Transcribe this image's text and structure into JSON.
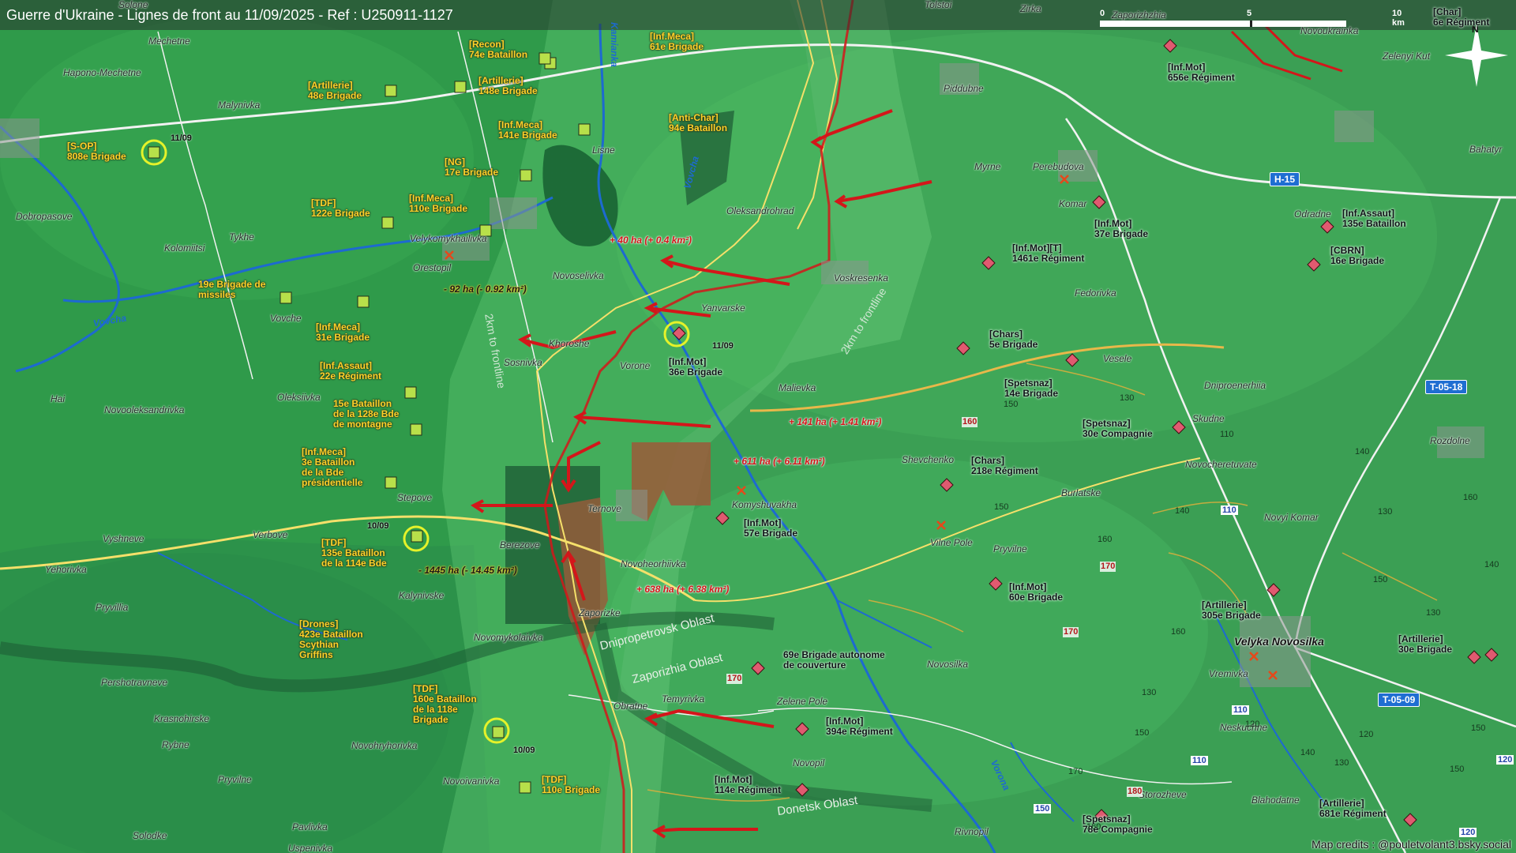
{
  "title": "Guerre d'Ukraine - Lignes de front au 11/09/2025 - Ref : U250911-1127",
  "credits": "Map credits : @pouletvolant3.bsky.social",
  "scale": {
    "zero": "0",
    "mid": "5",
    "end": "10 km"
  },
  "compass": "N",
  "colors": {
    "terrain": "#2f9a4a",
    "front_ru": "#d4161a",
    "ua_units": "#ffd22a",
    "ru_unit_marker": "#e05a70",
    "ua_unit_marker": "#b8e04a",
    "river": "#1d6ad0",
    "road_main": "#f2f2f2",
    "road_yellow": "#f5e06a"
  },
  "towns": {
    "solone": "Solone",
    "mechetne": "Mechetne",
    "hapono": "Hapono-Mechetne",
    "malynivka": "Malynivka",
    "dobropasove": "Dobropasove",
    "kolomiitsi": "Kolomiitsi",
    "tykhe": "Tykhe",
    "velykomykhailivka": "Velykomykhailivka",
    "orestopil": "Orestopil",
    "lisne": "Lisne",
    "oleksandrohrad": "Oleksandrohrad",
    "novoselivka": "Novoselivka",
    "yanvarske": "Yanvarske",
    "voskresenka": "Voskresenka",
    "khoroshe": "Khoroshe",
    "sosnivka": "Sosnivka",
    "vorone": "Vorone",
    "malievka": "Malievka",
    "vovche": "Vovche",
    "oleksiivka": "Oleksiivka",
    "novooleksandrivka": "Novooleksandrivka",
    "hai": "Hai",
    "stepove": "Stepove",
    "verbove": "Verbove",
    "vyshneve": "Vyshneve",
    "yehorivka": "Yehorivka",
    "ternove": "Ternove",
    "berezove": "Berezove",
    "novoheorhiivka": "Novoheorhiivka",
    "komyshuvakha": "Komyshuvakha",
    "kalynivske": "Kalynivske",
    "zaporizke": "Zaporizke",
    "pryvillia": "Pryvillia",
    "novomykolaivka": "Novomykolaivka",
    "pershotravneve": "Pershotravneve",
    "krasnohirske": "Krasnohirske",
    "rybne": "Rybne",
    "novohryhorivka": "Novohryhorivka",
    "pryvilne_w": "Pryvilne",
    "novoivanivka": "Novoivanivka",
    "solodke": "Solodke",
    "pavlivka": "Pavlivka",
    "uspenivka": "Uspenivka",
    "obratne": "Obratne",
    "temyrivka": "Temyrivka",
    "zelene_pole": "Zelene Pole",
    "novopil": "Novopil",
    "rivnopil": "Rivnopil",
    "novosilka": "Novosilka",
    "vilne_pole": "Vilne Pole",
    "pryvilne": "Pryvilne",
    "shevchenko": "Shevchenko",
    "burlatske": "Burlatske",
    "vesele": "Vesele",
    "fedorivka": "Fedorivka",
    "myrne": "Myrne",
    "perebudova": "Perebudova",
    "komar": "Komar",
    "piddubne": "Piddubne",
    "tolstoi": "Tolstoi",
    "zirka": "Zirka",
    "zaporizhzhia": "Zaporizhzhia",
    "novoukrainka": "Novoukrainka",
    "zelenyi_kut": "Zelenyi Kut",
    "bahatyr": "Bahatyr",
    "odradne": "Odradne",
    "dniproenerhiia": "Dniproenerhiia",
    "skudne": "Skudne",
    "novocheretuvate": "Novocheretuvate",
    "rozdolne": "Rozdolne",
    "novyi_komar": "Novyi Komar",
    "velyka_novosilka": "Velyka Novosilka",
    "vremivka": "Vremivka",
    "neskuchne": "Neskuchne",
    "storozheve": "Storozheve",
    "blahodatne": "Blahodatne"
  },
  "rivers": {
    "vovcha_w": "Vovcha",
    "vovcha_n": "Vovcha",
    "kamianka": "Kamianka",
    "vorona": "Vorona"
  },
  "oblasts": {
    "dnipro": "Dnipropetrovsk Oblast",
    "zap": "Zaporizhia Oblast",
    "donetsk": "Donetsk Oblast"
  },
  "frontline_notes": {
    "a": "2km to frontline",
    "b": "2km to frontline"
  },
  "gains": {
    "g1": "+ 40 ha (+ 0.4 km²)",
    "g2": "+ 141 ha (+ 1.41 km²)",
    "g3": "+ 611 ha (+ 6.11 km²)",
    "g4": "+ 638 ha (+ 6.38 km²)",
    "l1": "- 92 ha (- 0.92 km²)",
    "l2": "- 1445 ha (- 14.45 km²)"
  },
  "dates": {
    "d1": "11/09",
    "d2": "11/09",
    "d3": "10/09",
    "d4": "10/09"
  },
  "ua_units": {
    "u1": [
      "[Recon]",
      "74e Bataillon"
    ],
    "u2": [
      "[Inf.Meca]",
      "61e Brigade"
    ],
    "u3": [
      "[Artillerie]",
      "48e Brigade"
    ],
    "u4": [
      "[Artillerie]",
      "148e Brigade"
    ],
    "u5": [
      "[Inf.Meca]",
      "141e Brigade"
    ],
    "u6": [
      "[Anti-Char]",
      "94e Bataillon"
    ],
    "u7": [
      "[S-OP]",
      "808e Brigade"
    ],
    "u8": [
      "[NG]",
      "17e Brigade"
    ],
    "u9": [
      "[TDF]",
      "122e Brigade"
    ],
    "u10": [
      "[Inf.Meca]",
      "110e Brigade"
    ],
    "u11": [
      "19e Brigade de",
      "missiles"
    ],
    "u12": [
      "[Inf.Meca]",
      "31e Brigade"
    ],
    "u13": [
      "[Inf.Assaut]",
      "22e Régiment"
    ],
    "u14": [
      "15e Bataillon",
      "de la 128e Bde",
      "de montagne"
    ],
    "u15": [
      "[Inf.Meca]",
      "3e Bataillon",
      "de la Bde",
      "présidentielle"
    ],
    "u16": [
      "[TDF]",
      "135e Bataillon",
      "de la 114e Bde"
    ],
    "u17": [
      "[Drones]",
      "423e Bataillon",
      "Scythian",
      "Griffins"
    ],
    "u18": [
      "[TDF]",
      "160e Bataillon",
      "de la 118e",
      "Brigade"
    ],
    "u19": [
      "[TDF]",
      "110e Brigade"
    ]
  },
  "ru_units": {
    "r1": [
      "[Inf.Mot]",
      "656e Régiment"
    ],
    "r2": [
      "[Char]",
      "6e Régiment"
    ],
    "r3": [
      "[Inf.Mot]",
      "37e Brigade"
    ],
    "r4": [
      "[Inf.Mot][T]",
      "1461e Régiment"
    ],
    "r5": [
      "[Inf.Assaut]",
      "135e Bataillon"
    ],
    "r6": [
      "[CBRN]",
      "16e Brigade"
    ],
    "r7": [
      "[Chars]",
      "5e Brigade"
    ],
    "r8": [
      "[Spetsnaz]",
      "14e Brigade"
    ],
    "r9": [
      "[Spetsnaz]",
      "30e Compagnie"
    ],
    "r10": [
      "[Inf.Mot]",
      "36e Brigade"
    ],
    "r11": [
      "[Chars]",
      "218e Régiment"
    ],
    "r12": [
      "[Inf.Mot]",
      "57e Brigade"
    ],
    "r13": [
      "[Inf.Mot]",
      "60e Brigade"
    ],
    "r14": [
      "[Artillerie]",
      "305e Brigade"
    ],
    "r15": [
      "[Artillerie]",
      "30e Brigade"
    ],
    "r16": [
      "69e Brigade autonome",
      "de couverture"
    ],
    "r17": [
      "[Inf.Mot]",
      "394e Régiment"
    ],
    "r18": [
      "[Inf.Mot]",
      "114e Régiment"
    ],
    "r19": [
      "[Spetsnaz]",
      "78e Compagnie"
    ],
    "r20": [
      "[Artillerie]",
      "681e Régiment"
    ]
  },
  "elevations": {
    "e1": "130",
    "e2": "150",
    "e3": "150",
    "e4": "140",
    "e5": "110",
    "e6": "140",
    "e7": "130",
    "e8": "160",
    "e9": "150",
    "e10": "160",
    "e11": "140",
    "e12": "130",
    "e13": "150",
    "e14": "160",
    "e15": "130",
    "e16": "120",
    "e17": "150",
    "e18": "170",
    "e19": "160",
    "e20": "120",
    "e21": "140",
    "e22": "130",
    "e23": "150"
  },
  "elevations_red": {
    "h1": "160",
    "h2": "170",
    "h3": "170",
    "h4": "170",
    "h5": "180"
  },
  "roads": {
    "h15": "H-15",
    "t0518": "T-05-18",
    "t0509": "T-05-09",
    "n110a": "110",
    "n110b": "110",
    "n110c": "110",
    "n120a": "120",
    "n120b": "120",
    "n150": "150"
  }
}
